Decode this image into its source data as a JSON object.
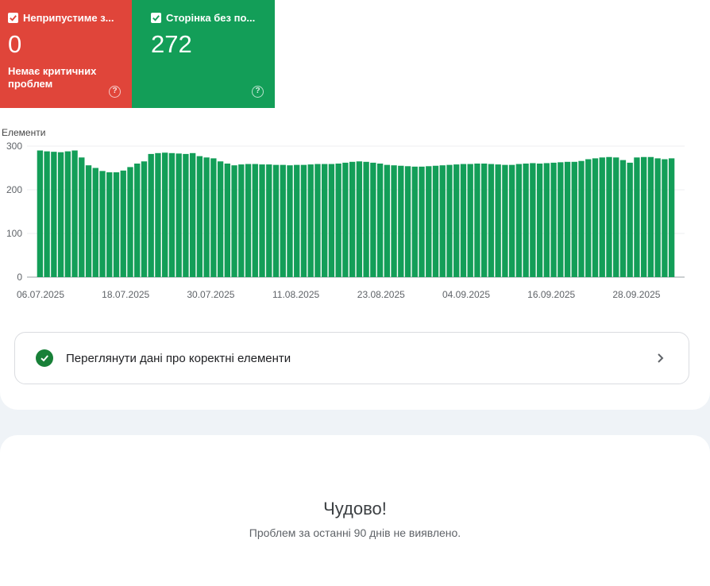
{
  "tiles": [
    {
      "label": "Неприпустиме з...",
      "value": "0",
      "sub": "Немає критичних проблем",
      "color": "#e0453a"
    },
    {
      "label": "Сторінка без по...",
      "value": "272",
      "color": "#139e58"
    }
  ],
  "chart_data": {
    "type": "bar",
    "title": "",
    "ylabel": "Елементи",
    "ylim": [
      0,
      300
    ],
    "yticks": [
      0,
      100,
      200,
      300
    ],
    "xtick_labels": [
      "06.07.2025",
      "18.07.2025",
      "30.07.2025",
      "11.08.2025",
      "23.08.2025",
      "04.09.2025",
      "16.09.2025",
      "28.09.2025"
    ],
    "bar_color": "#139e58",
    "values": [
      290,
      288,
      287,
      286,
      288,
      290,
      274,
      256,
      250,
      243,
      240,
      240,
      244,
      252,
      260,
      265,
      282,
      284,
      285,
      284,
      283,
      282,
      284,
      277,
      274,
      272,
      265,
      260,
      256,
      258,
      259,
      259,
      258,
      258,
      257,
      257,
      256,
      257,
      257,
      258,
      259,
      259,
      259,
      260,
      262,
      264,
      265,
      264,
      262,
      260,
      257,
      256,
      255,
      254,
      253,
      253,
      254,
      255,
      256,
      257,
      258,
      259,
      259,
      260,
      260,
      259,
      258,
      257,
      257,
      259,
      260,
      261,
      260,
      261,
      262,
      263,
      264,
      264,
      266,
      270,
      272,
      274,
      275,
      274,
      268,
      262,
      274,
      275,
      275,
      272,
      270,
      272
    ]
  },
  "link": {
    "label": "Переглянути дані про коректні елементи"
  },
  "status": {
    "title": "Чудово!",
    "subtitle": "Проблем за останні 90 днів не виявлено."
  }
}
